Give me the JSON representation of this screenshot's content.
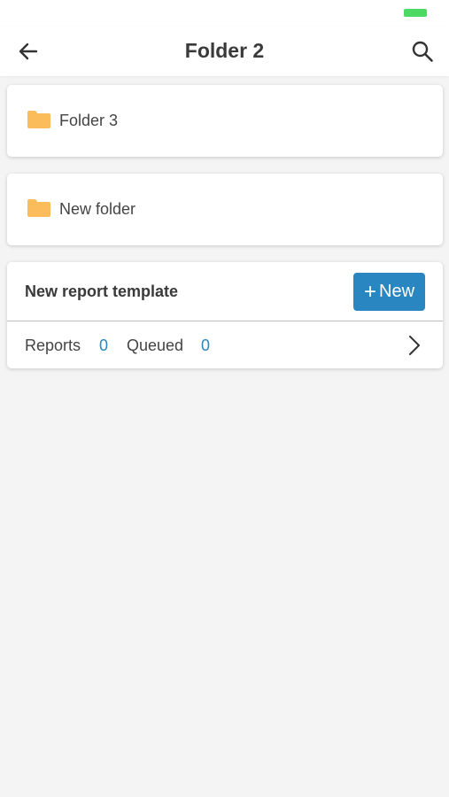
{
  "status_bar": {
    "battery_color": "#4cd964"
  },
  "header": {
    "title": "Folder 2",
    "back_icon": "arrow-left-icon",
    "search_icon": "search-icon"
  },
  "folders": [
    {
      "label": "Folder 3",
      "icon": "folder-icon"
    },
    {
      "label": "New folder",
      "icon": "folder-icon"
    }
  ],
  "report_template": {
    "title": "New report template",
    "new_button": {
      "plus": "+",
      "label": "New"
    },
    "reports_label": "Reports",
    "reports_count": "0",
    "queued_label": "Queued",
    "queued_count": "0"
  },
  "colors": {
    "accent": "#2a86c0",
    "folder": "#fbbd5c",
    "background": "#f4f4f4"
  }
}
